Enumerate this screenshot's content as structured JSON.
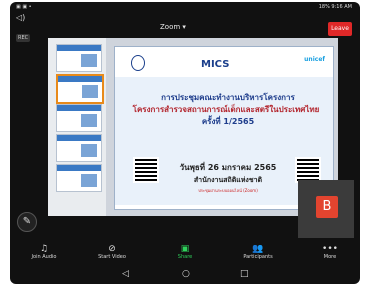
{
  "statusbar": {
    "left_icons": "▣ ▣ •",
    "right_text": "18% 9:16 AM"
  },
  "meeting": {
    "title": "Zoom ▾",
    "rec_badge": "REC",
    "leave_label": "Leave"
  },
  "slide": {
    "brand": "MICS",
    "partner": "unicef",
    "title_line1": "การประชุมคณะทำงานบริหารโครงการ",
    "title_line2": "โครงการสำรวจสถานการณ์เด็กและสตรีในประเทศไทย",
    "title_line3": "ครั้งที่ 1/2565",
    "date_line": "วันพุธที่ 26 มกราคม 2565",
    "org_line": "สำนักงานสถิติแห่งชาติ",
    "small_line": "ประชุมผ่านระบบออนไลน์ (Zoom)"
  },
  "participant": {
    "initial": "B"
  },
  "toolbar": {
    "audio_label": "Join Audio",
    "video_label": "Start Video",
    "share_label": "Share",
    "participants_label": "Participants",
    "more_label": "More"
  },
  "colors": {
    "leave": "#e02828",
    "share_active": "#2fd15b",
    "avatar": "#e2442f"
  }
}
